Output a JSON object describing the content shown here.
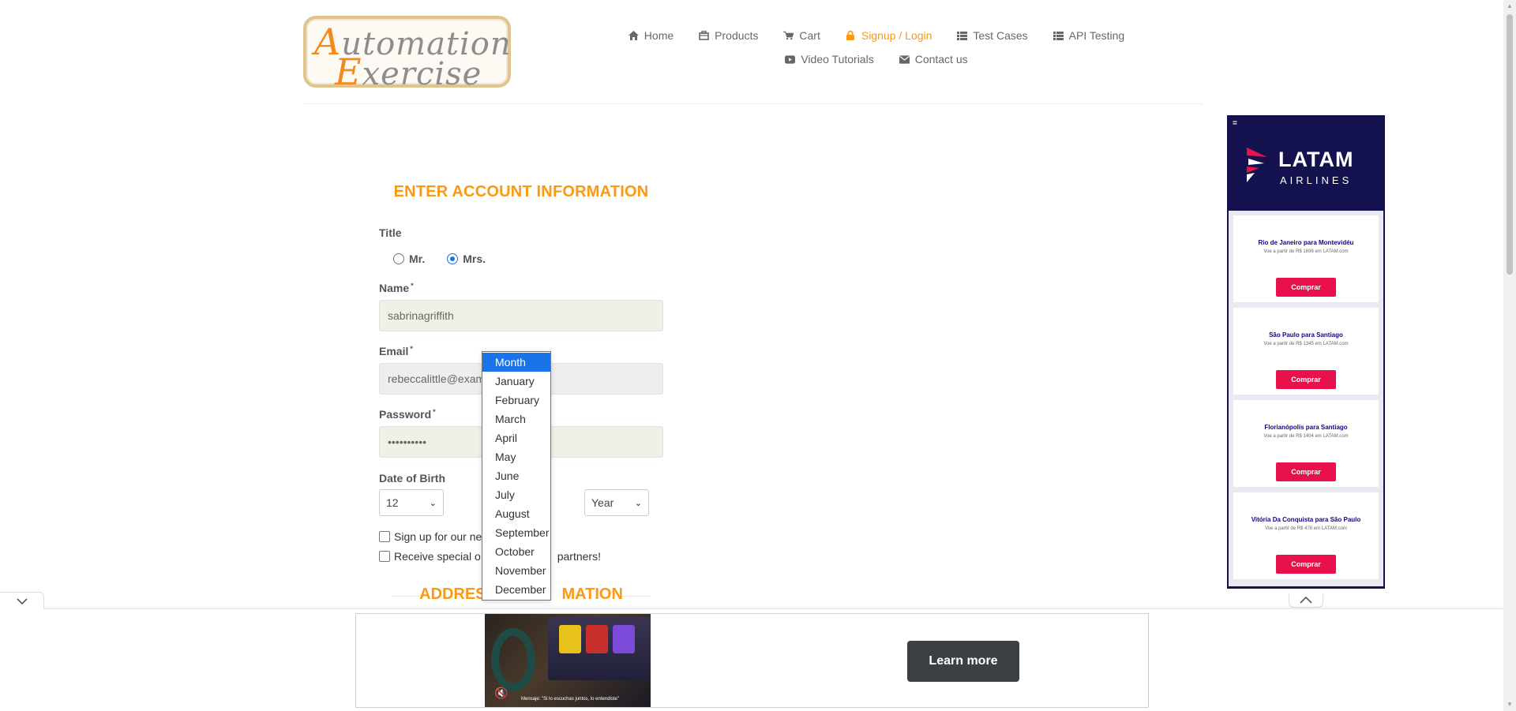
{
  "logo": {
    "line1_cap": "A",
    "line1_rest": "utomation",
    "line2_cap": "E",
    "line2_rest": "xercise"
  },
  "nav": {
    "items": [
      {
        "label": "Home",
        "icon": "home-icon"
      },
      {
        "label": "Products",
        "icon": "products-icon"
      },
      {
        "label": "Cart",
        "icon": "cart-icon"
      },
      {
        "label": "Signup / Login",
        "icon": "lock-icon",
        "active": true
      },
      {
        "label": "Test Cases",
        "icon": "list-icon"
      },
      {
        "label": "API Testing",
        "icon": "list-icon"
      },
      {
        "label": "Video Tutorials",
        "icon": "youtube-icon"
      },
      {
        "label": "Contact us",
        "icon": "envelope-icon"
      }
    ],
    "active_color": "#fe980f"
  },
  "form": {
    "title": "ENTER ACCOUNT INFORMATION",
    "title_label": "Title",
    "title_options": [
      {
        "label": "Mr.",
        "checked": false
      },
      {
        "label": "Mrs.",
        "checked": true
      }
    ],
    "name_label": "Name",
    "name_value": "sabrinagriffith",
    "email_label": "Email",
    "email_value": "rebeccalittle@exam",
    "password_label": "Password",
    "password_value": "••••••••••",
    "required_mark": "*",
    "dob_label": "Date of Birth",
    "day_value": "12",
    "year_value": "Year",
    "newsletter_label": "Sign up for our ne",
    "offers_label_start": "Receive special o",
    "offers_label_end": "partners!",
    "address_title_start": "ADDRES",
    "address_title_end": "MATION"
  },
  "month_dropdown": {
    "selected": "Month",
    "options": [
      "Month",
      "January",
      "February",
      "March",
      "April",
      "May",
      "June",
      "July",
      "August",
      "September",
      "October",
      "November",
      "December"
    ],
    "highlight_color": "#1a73e8"
  },
  "ad_right": {
    "menu_glyph": "=",
    "brand": "LATAM",
    "brand_sub": "AIRLINES",
    "bg_color": "#13124f",
    "button_color": "#e8114b",
    "offers": [
      {
        "title": "Rio de Janeiro para Montevidéu",
        "sub": "Voe a partir de R$ 1696 em LATAM.com",
        "button": "Comprar"
      },
      {
        "title": "São Paulo para Santiago",
        "sub": "Voe a partir de R$ 1345 em LATAM.com",
        "button": "Comprar"
      },
      {
        "title": "Florianópolis para Santiago",
        "sub": "Voe a partir de R$ 1404 em LATAM.com",
        "button": "Comprar"
      },
      {
        "title": "Vitória Da Conquista para São Paulo",
        "sub": "Voe a partir de R$ 478 em LATAM.com",
        "button": "Comprar"
      }
    ]
  },
  "ad_bottom": {
    "learn_more": "Learn more",
    "video_caption": "Mensaje: \"Si lo escuchas juntos, lo entendiste\""
  }
}
